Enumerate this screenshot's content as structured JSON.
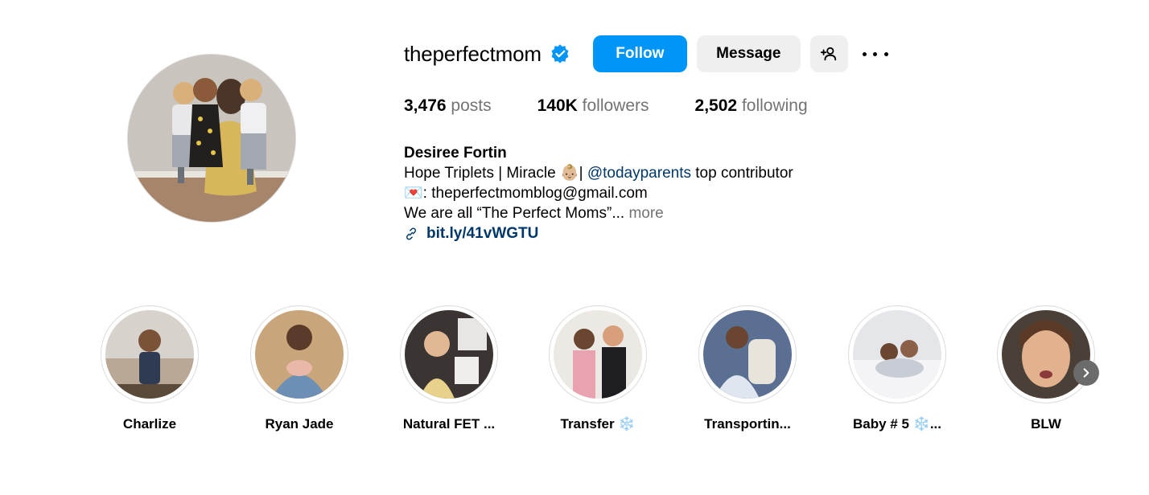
{
  "profile": {
    "username": "theperfectmom",
    "verified": true,
    "follow_label": "Follow",
    "message_label": "Message",
    "add_user_icon": "person-add-icon",
    "more_icon": "more-horizontal-icon"
  },
  "stats": {
    "posts_count": "3,476",
    "posts_label": "posts",
    "followers_count": "140K",
    "followers_label": "followers",
    "following_count": "2,502",
    "following_label": "following"
  },
  "bio": {
    "name": "Desiree Fortin",
    "line1_prefix": "Hope Triplets | Miracle ",
    "line1_emoji": "👶🏼",
    "line1_sep": "| ",
    "line1_mention": "@todayparents",
    "line1_suffix": " top contributor",
    "line2_emoji": "💌",
    "line2_text": ": theperfectmomblog@gmail.com",
    "line3_text": "We are all “The Perfect Moms”...",
    "line3_more": " more",
    "link_text": "bit.ly/41vWGTU",
    "link_icon": "link-icon"
  },
  "highlights": [
    {
      "label": "Charlize"
    },
    {
      "label": "Ryan Jade"
    },
    {
      "label": "Natural FET ..."
    },
    {
      "label": "Transfer ❄️"
    },
    {
      "label": "Transportin..."
    },
    {
      "label": "Baby # 5 ❄️..."
    },
    {
      "label": "BLW"
    }
  ],
  "highlights_next_icon": "chevron-right-icon",
  "colors": {
    "accent": "#0095f6",
    "verified": "#0095f6",
    "link": "#00376b",
    "muted": "#737373",
    "button_bg": "#efefef"
  }
}
